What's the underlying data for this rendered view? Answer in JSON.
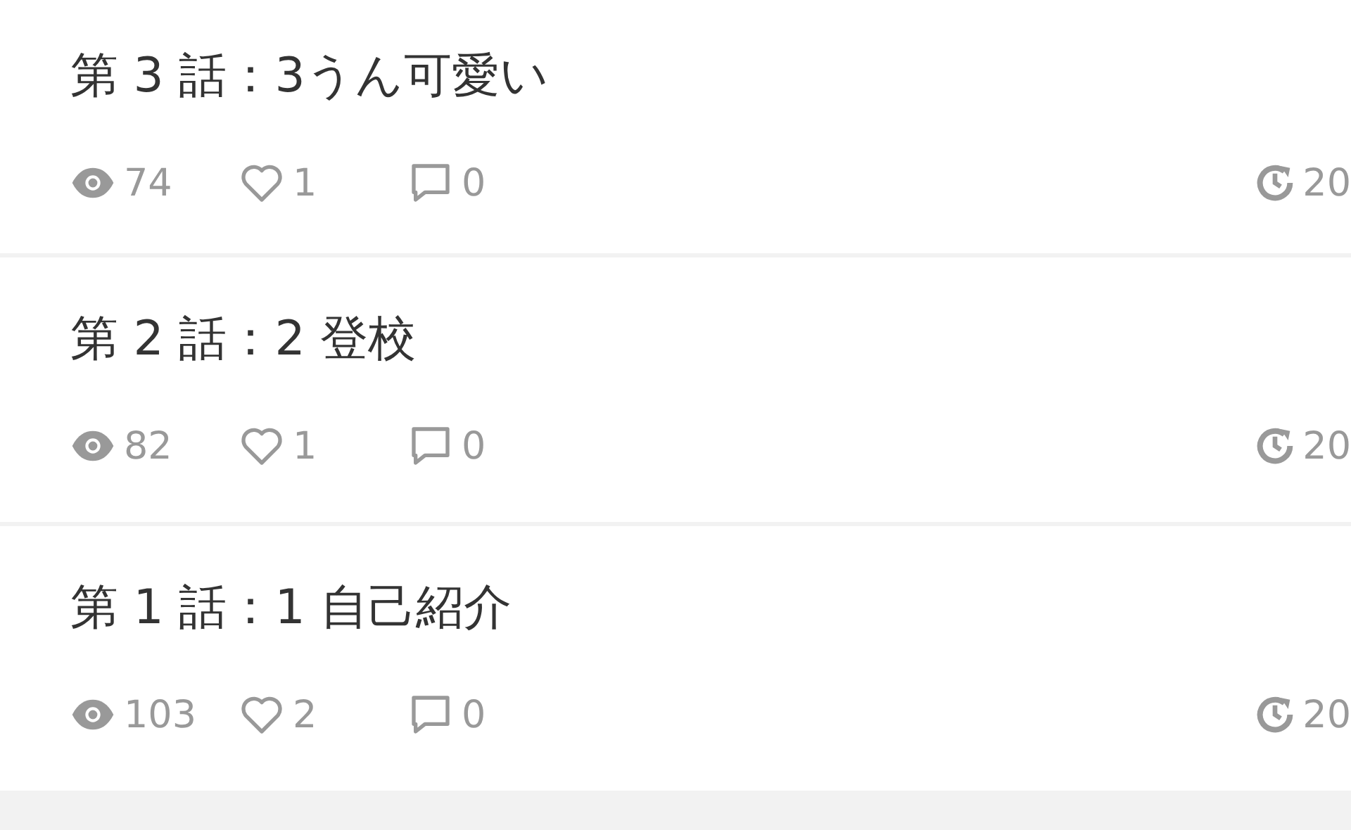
{
  "episodes": [
    {
      "title": "第 3 話：3うん可愛い",
      "views": "74",
      "likes": "1",
      "comments": "0",
      "date": "20"
    },
    {
      "title": "第 2 話：2 登校",
      "views": "82",
      "likes": "1",
      "comments": "0",
      "date": "20"
    },
    {
      "title": "第 1 話：1 自己紹介",
      "views": "103",
      "likes": "2",
      "comments": "0",
      "date": "20"
    }
  ]
}
